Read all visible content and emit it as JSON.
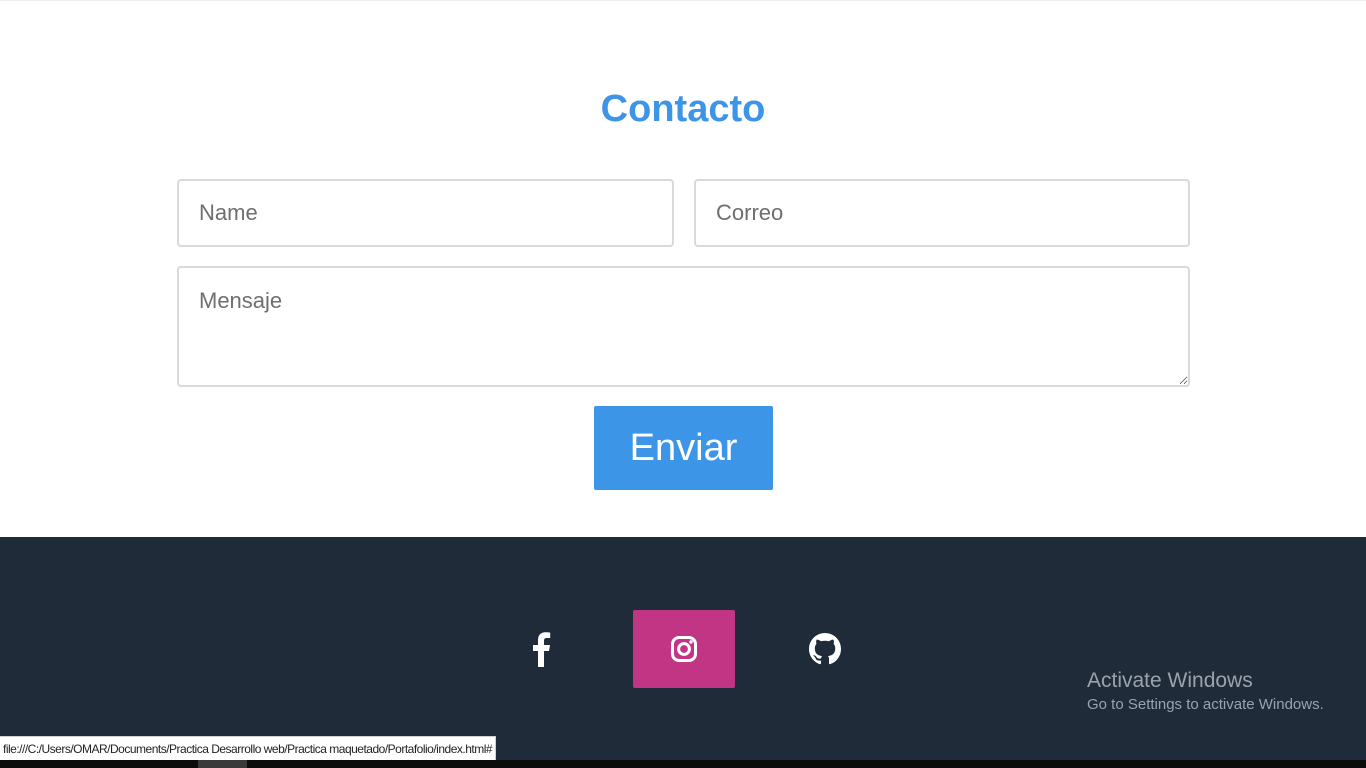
{
  "contact": {
    "title": "Contacto",
    "name_placeholder": "Name",
    "email_placeholder": "Correo",
    "message_placeholder": "Mensaje",
    "send_label": "Enviar"
  },
  "footer": {
    "social": [
      {
        "name": "facebook",
        "icon": "facebook-icon",
        "bg": "transparent",
        "active": false
      },
      {
        "name": "instagram",
        "icon": "instagram-icon",
        "bg": "#c13584",
        "active": true
      },
      {
        "name": "github",
        "icon": "github-icon",
        "bg": "transparent",
        "active": false
      }
    ]
  },
  "watermark": {
    "title": "Activate Windows",
    "subtitle": "Go to Settings to activate Windows."
  },
  "status_bar": {
    "url": "file:///C:/Users/OMAR/Documents/Practica Desarrollo web/Practica maquetado/Portafolio/index.html#"
  },
  "colors": {
    "accent": "#3d95e8",
    "footer_bg": "#1f2b38",
    "instagram": "#c13584"
  }
}
